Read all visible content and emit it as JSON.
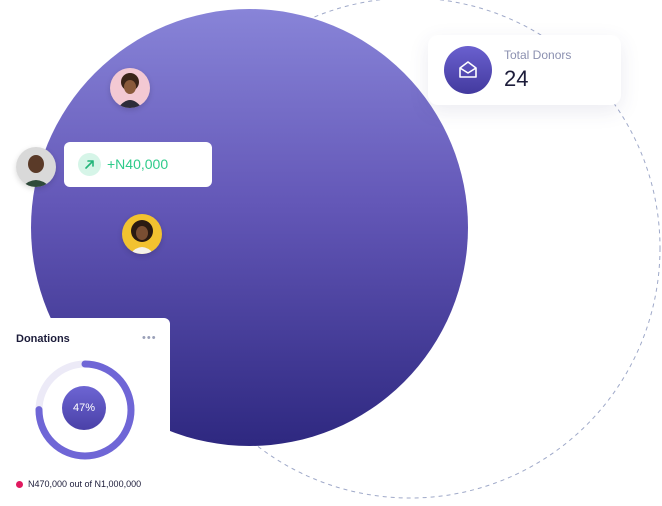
{
  "donors_card": {
    "label": "Total Donors",
    "value": "24",
    "icon": "envelope-icon"
  },
  "amount_pill": {
    "text": "+N40,000",
    "icon": "arrow-up-right-icon"
  },
  "donations_card": {
    "title": "Donations",
    "menu_icon": "more-horizontal-icon",
    "percent_label": "47%",
    "percent_value": 47,
    "legend_text": "N470,000 out of N1,000,000"
  },
  "colors": {
    "accent": "#5a50c4",
    "positive": "#2ecb8a",
    "legend_dot": "#e0195f"
  }
}
